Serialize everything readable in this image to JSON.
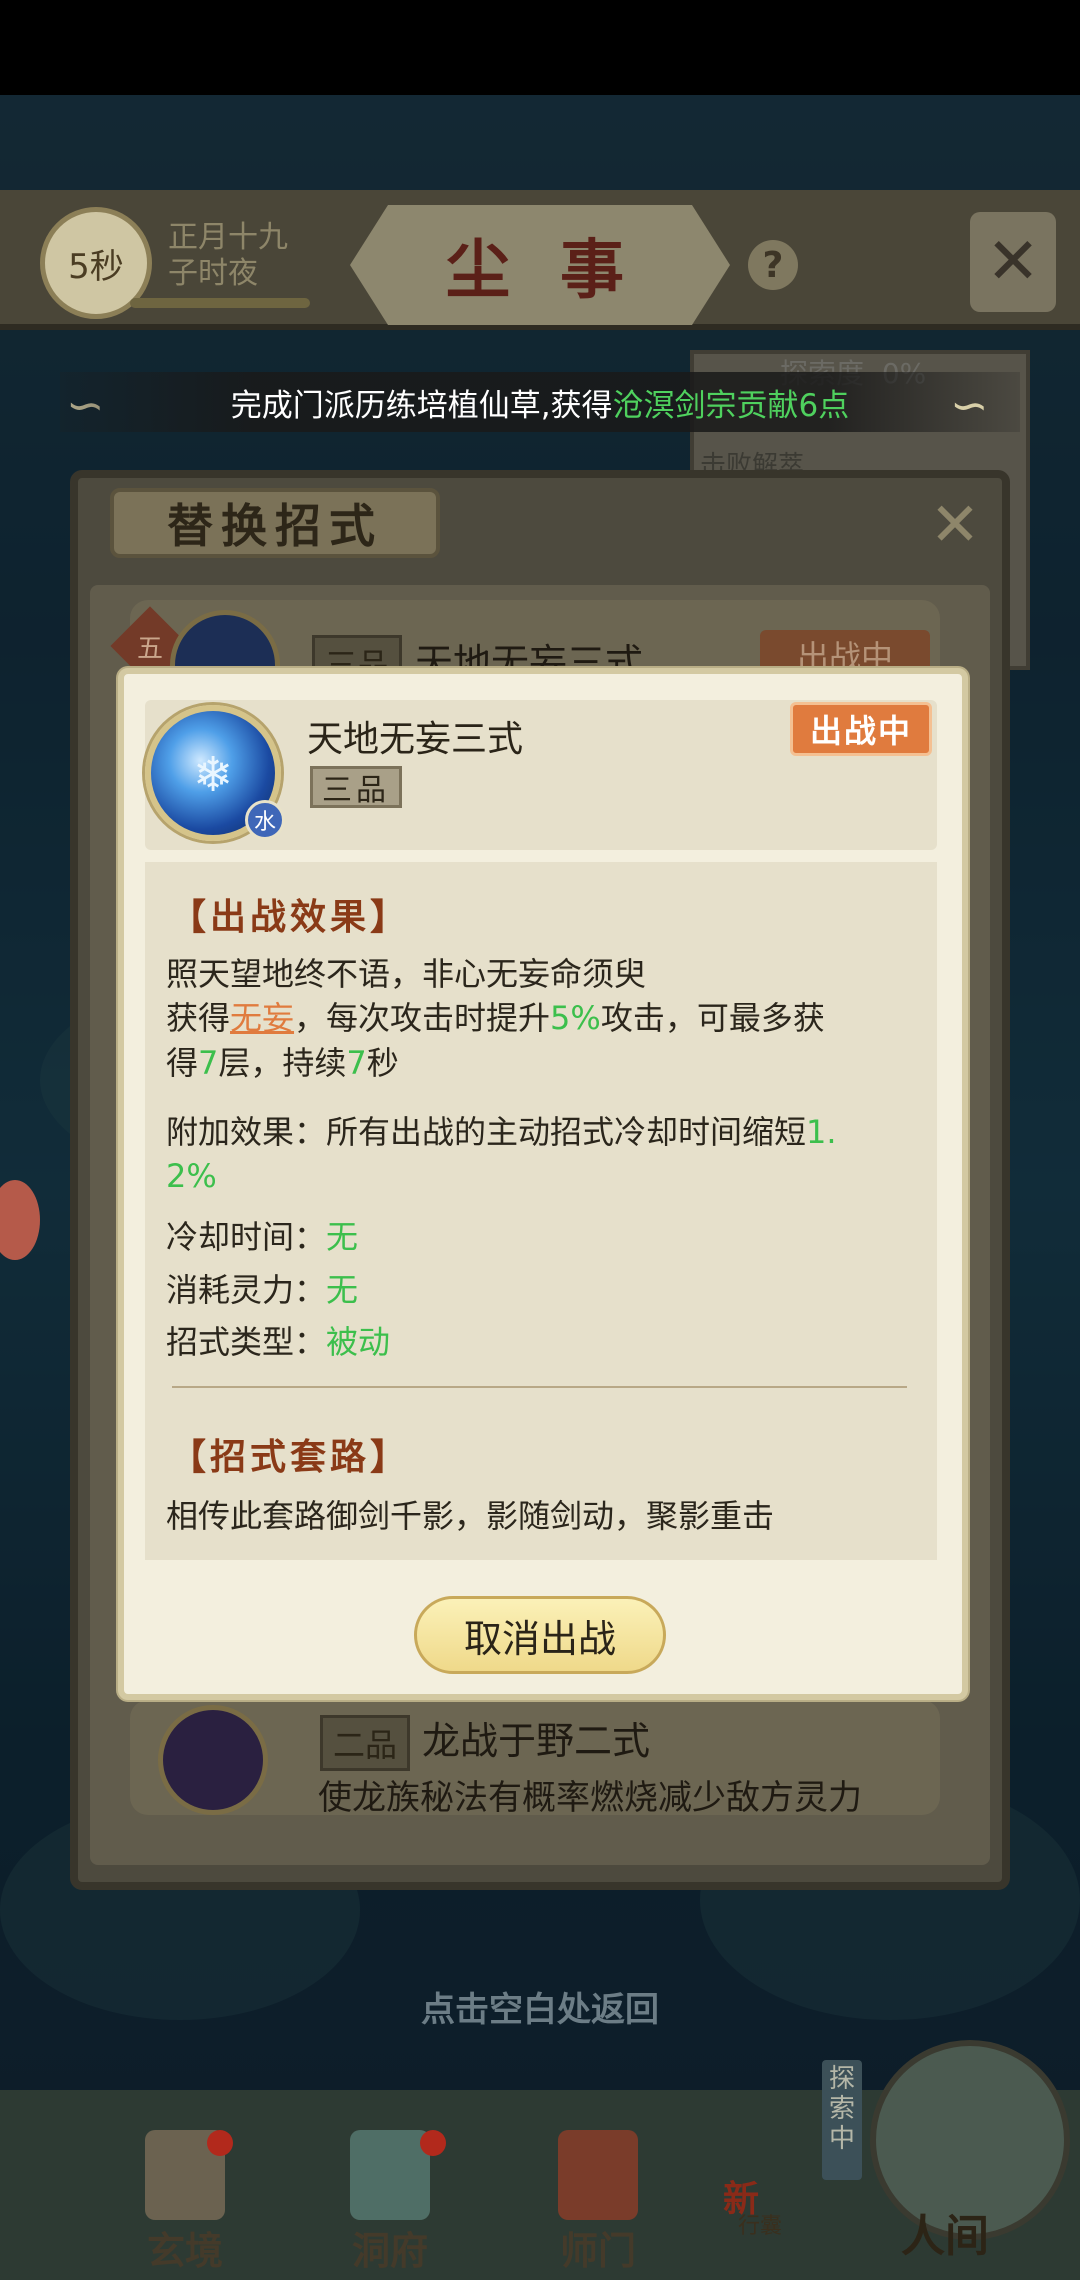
{
  "header": {
    "timer": "5秒",
    "date_line1": "正月十九",
    "date_line2": "子时夜",
    "title": "尘事",
    "help_glyph": "?"
  },
  "notice": {
    "text_before": "完成门派历练培植仙草,获得",
    "highlight": "沧溟剑宗贡献6点"
  },
  "explore_panel": {
    "label": "探索度",
    "percent": "0%",
    "sub": "击败解萃"
  },
  "replace_panel": {
    "title": "替换招式",
    "rows": [
      {
        "badge": "五",
        "grade": "三品",
        "name": "天地无妄三式",
        "status": "出战中"
      },
      {
        "grade": "二品",
        "name": "龙战于野二式",
        "desc": "使龙族秘法有概率燃烧减少敌方灵力"
      }
    ]
  },
  "popup": {
    "skill_name": "天地无妄三式",
    "grade": "三品",
    "element": "水",
    "status": "出战中",
    "effect_title": "【出战效果】",
    "effect_poem": "照天望地终不语，非心无妄命须臾",
    "effect_line1_a": "获得",
    "effect_line1_link": "无妄",
    "effect_line1_b": "，每次攻击时提升",
    "effect_line1_pct": "5%",
    "effect_line1_c": "攻击，可最多获",
    "effect_line2_a": "得",
    "effect_line2_layers": "7",
    "effect_line2_b": "层，持续",
    "effect_line2_secs": "7",
    "effect_line2_c": "秒",
    "extra_label": "附加效果：所有出战的主动招式冷却时间缩短",
    "extra_value_part1": "1.",
    "extra_value_part2": "2%",
    "cooldown_label": "冷却时间：",
    "cooldown_value": "无",
    "cost_label": "消耗灵力：",
    "cost_value": "无",
    "type_label": "招式类型：",
    "type_value": "被动",
    "routine_title": "【招式套路】",
    "routine_text": "相传此套路御剑千影，影随剑动，聚影重击",
    "cancel_button": "取消出战"
  },
  "hint": "点击空白处返回",
  "bottom_nav": {
    "items": [
      "玄境",
      "洞府",
      "师门"
    ],
    "bag_new": "新",
    "bag_label": "行囊",
    "explore_tag": "探索中",
    "world": "人间"
  },
  "colors": {
    "accent_green": "#3cbf4c",
    "status_orange": "#e07b3e",
    "section_brown": "#8a3a17"
  }
}
